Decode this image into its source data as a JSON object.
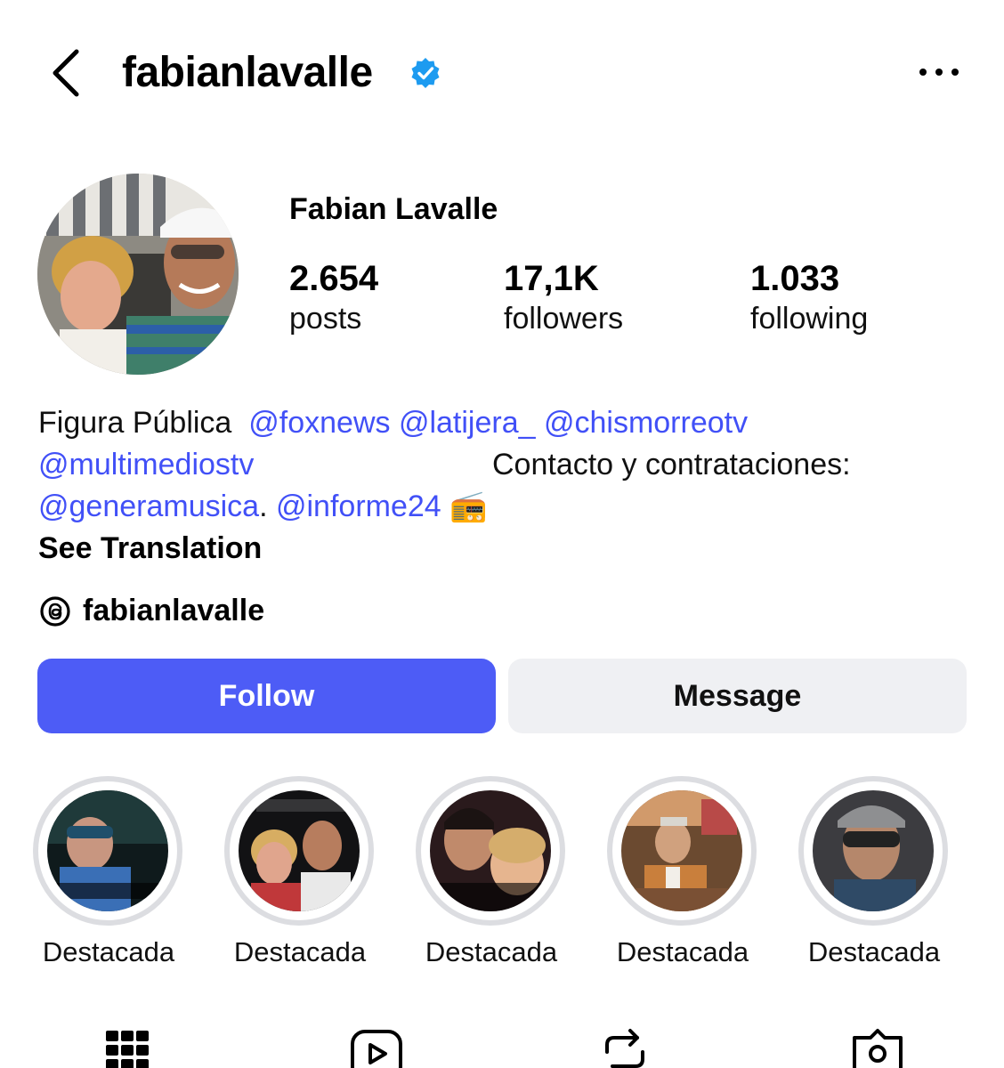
{
  "header": {
    "username": "fabianlavalle",
    "back_icon": "chevron-left-icon",
    "verified_icon": "verified-badge-icon",
    "more_icon": "more-horizontal-icon"
  },
  "profile": {
    "full_name": "Fabian Lavalle",
    "stats": [
      {
        "value": "2.654",
        "label": "posts"
      },
      {
        "value": "17,1K",
        "label": "followers"
      },
      {
        "value": "1.033",
        "label": "following"
      }
    ]
  },
  "bio": {
    "line1_text": "Figura Pública",
    "line1_mentions": "@foxnews @latijera_ @chismorreotv",
    "line2_mention": "@multimediostv",
    "line2_text": "Contacto y contrataciones:",
    "line3_mention1": "@generamusica",
    "line3_sep": ".",
    "line3_mention2": "@informe24",
    "emoji": "📻",
    "see_translation": "See Translation",
    "threads_icon": "threads-icon",
    "threads_handle": "fabianlavalle"
  },
  "actions": {
    "follow": "Follow",
    "message": "Message"
  },
  "highlights": [
    {
      "label": "Destacada"
    },
    {
      "label": "Destacada"
    },
    {
      "label": "Destacada"
    },
    {
      "label": "Destacada"
    },
    {
      "label": "Destacada"
    }
  ],
  "tabs": [
    "grid-icon",
    "reels-icon",
    "reposts-icon",
    "tagged-icon"
  ],
  "colors": {
    "accent": "#4d5cf6",
    "mention": "#4150f7",
    "verified": "#1d9bf0",
    "message_bg": "#eff0f3"
  }
}
